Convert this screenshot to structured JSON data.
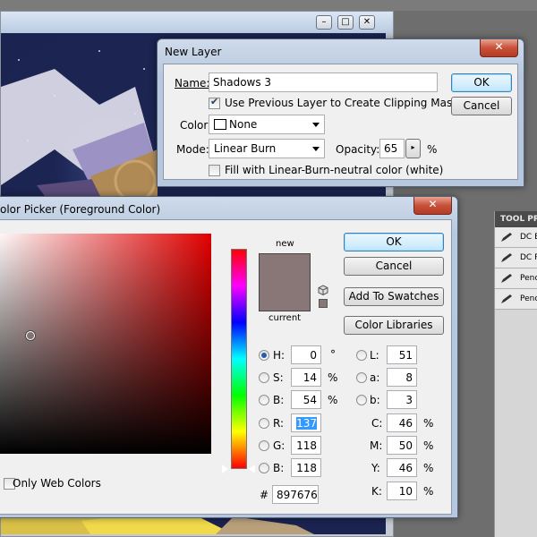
{
  "background": {
    "tool_panel": {
      "title": "TOOL PR",
      "items": [
        "DC E",
        "DC P",
        "Penc",
        "Penc"
      ]
    },
    "window_controls": [
      "–",
      "□",
      "✕"
    ]
  },
  "new_layer": {
    "title": "New Layer",
    "close_glyph": "✕",
    "name_label": "Name:",
    "name_value": "Shadows 3",
    "clipping_label": "Use Previous Layer to Create Clipping Mask",
    "clipping_checked": true,
    "color_label": "Color:",
    "color_value": "None",
    "mode_label": "Mode:",
    "mode_value": "Linear Burn",
    "opacity_label": "Opacity:",
    "opacity_value": "65",
    "opacity_unit": "%",
    "fill_label": "Fill with Linear-Burn-neutral color (white)",
    "fill_checked": false,
    "ok_label": "OK",
    "cancel_label": "Cancel"
  },
  "color_picker": {
    "title": "olor Picker (Foreground Color)",
    "close_glyph": "✕",
    "ok_label": "OK",
    "cancel_label": "Cancel",
    "add_swatches_label": "Add To Swatches",
    "libraries_label": "Color Libraries",
    "new_label": "new",
    "current_label": "current",
    "new_color": "#897676",
    "current_color": "#897676",
    "only_web_label": "Only Web Colors",
    "hsb": [
      {
        "label": "H:",
        "value": "0",
        "unit": "°",
        "selected": true
      },
      {
        "label": "S:",
        "value": "14",
        "unit": "%",
        "selected": false
      },
      {
        "label": "B:",
        "value": "54",
        "unit": "%",
        "selected": false
      }
    ],
    "rgb": [
      {
        "label": "R:",
        "value": "137",
        "selected": false
      },
      {
        "label": "G:",
        "value": "118",
        "selected": false
      },
      {
        "label": "B:",
        "value": "118",
        "selected": false
      }
    ],
    "lab": [
      {
        "label": "L:",
        "value": "51"
      },
      {
        "label": "a:",
        "value": "8"
      },
      {
        "label": "b:",
        "value": "3"
      }
    ],
    "cmyk": [
      {
        "label": "C:",
        "value": "46",
        "unit": "%"
      },
      {
        "label": "M:",
        "value": "50",
        "unit": "%"
      },
      {
        "label": "Y:",
        "value": "46",
        "unit": "%"
      },
      {
        "label": "K:",
        "value": "10",
        "unit": "%"
      }
    ],
    "hex_label": "#",
    "hex_value": "897676"
  }
}
